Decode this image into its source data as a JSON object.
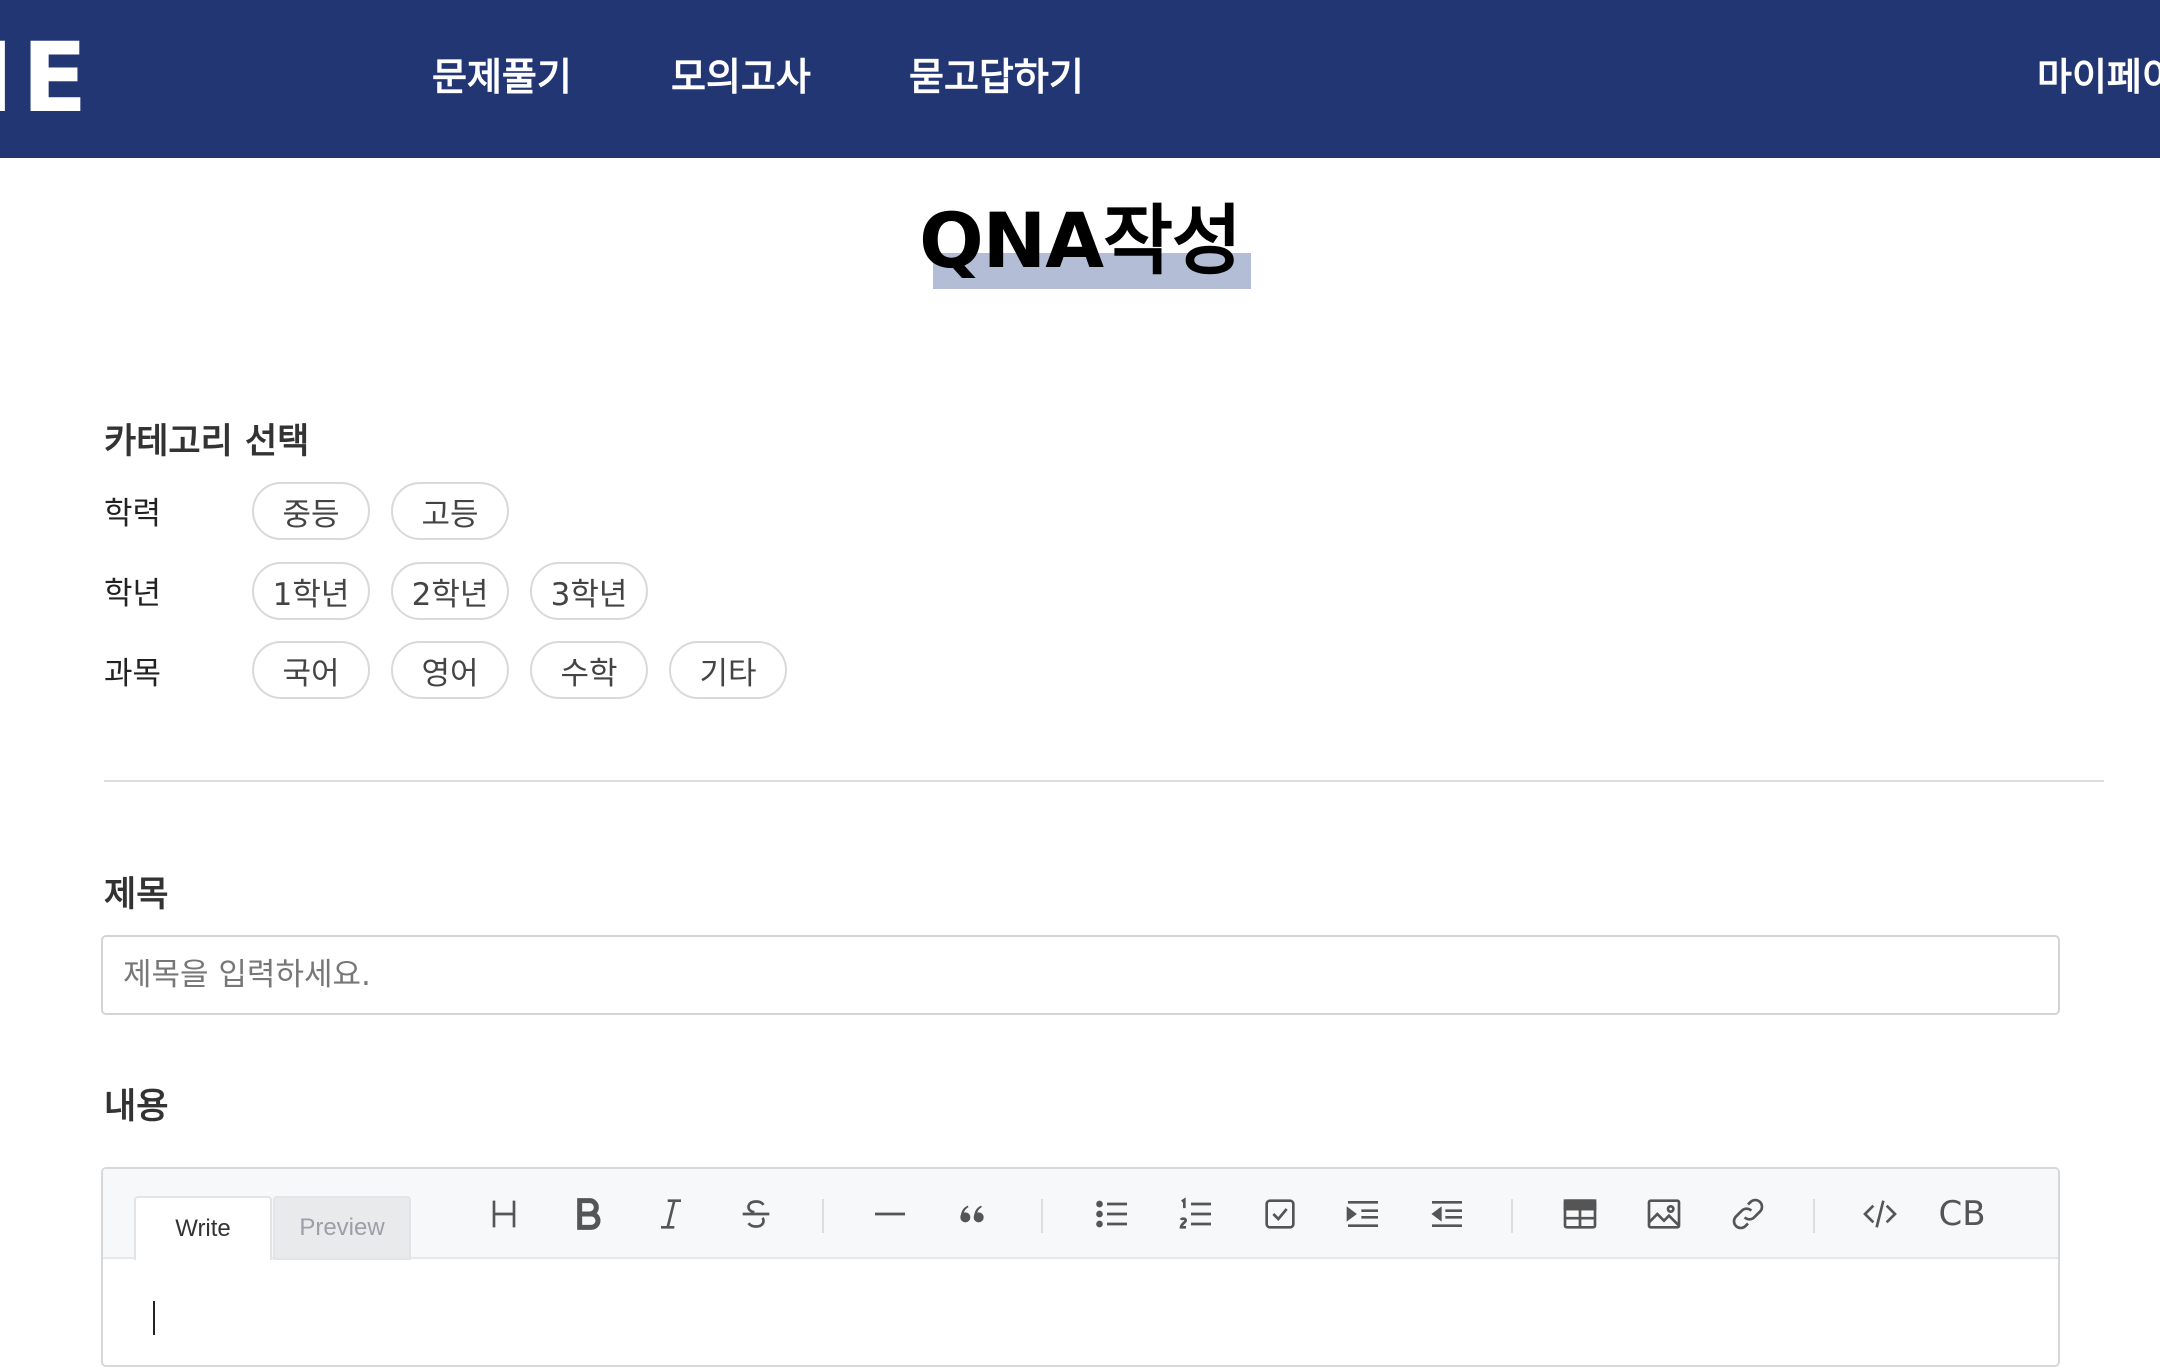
{
  "header": {
    "logo": "IE",
    "nav": [
      "문제풀기",
      "모의고사",
      "묻고답하기"
    ],
    "mypage": "마이페이"
  },
  "page_title": "QNA작성",
  "category": {
    "heading": "카테고리 선택",
    "rows": [
      {
        "label": "학력",
        "options": [
          "중등",
          "고등"
        ]
      },
      {
        "label": "학년",
        "options": [
          "1학년",
          "2학년",
          "3학년"
        ]
      },
      {
        "label": "과목",
        "options": [
          "국어",
          "영어",
          "수학",
          "기타"
        ]
      }
    ]
  },
  "title_field": {
    "label": "제목",
    "value": "",
    "placeholder": "제목을 입력하세요."
  },
  "content_field": {
    "label": "내용",
    "tabs": {
      "write": "Write",
      "preview": "Preview"
    },
    "tools": [
      "heading-icon",
      "bold-icon",
      "italic-icon",
      "strikethrough-icon",
      "horizontal-rule-icon",
      "quote-icon",
      "bullet-list-icon",
      "numbered-list-icon",
      "task-list-icon",
      "indent-icon",
      "outdent-icon",
      "table-icon",
      "image-icon",
      "link-icon",
      "code-icon",
      "code-block-icon"
    ],
    "code_block_label": "CB"
  },
  "colors": {
    "header_bg": "#233674",
    "title_highlight": "#b3bdd6"
  }
}
